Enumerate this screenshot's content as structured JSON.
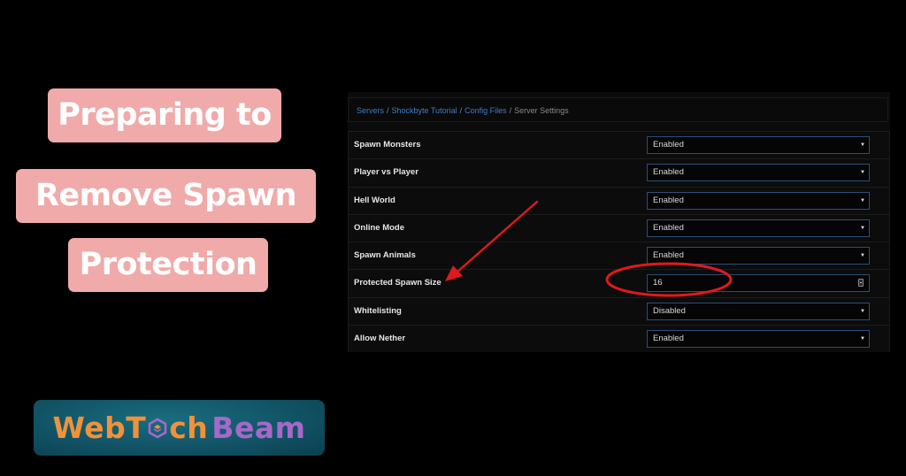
{
  "title_lines": [
    "Preparing to",
    "Remove Spawn",
    "Protection"
  ],
  "logo": {
    "part1": "WebT",
    "part2": "ch",
    "part3": "Beam",
    "colors": {
      "orange": "#f0923a",
      "purple": "#a668c9",
      "background": "#115466"
    }
  },
  "breadcrumb": {
    "items": [
      {
        "label": "Servers",
        "link": true
      },
      {
        "label": "Shockbyte Tutorial",
        "link": true
      },
      {
        "label": "Config Files",
        "link": true
      },
      {
        "label": "Server Settings",
        "link": false
      }
    ],
    "separator": "/"
  },
  "settings": [
    {
      "label": "Spawn Monsters",
      "type": "select",
      "value": "Enabled"
    },
    {
      "label": "Player vs Player",
      "type": "select",
      "value": "Enabled"
    },
    {
      "label": "Hell World",
      "type": "select",
      "value": "Enabled"
    },
    {
      "label": "Online Mode",
      "type": "select",
      "value": "Enabled"
    },
    {
      "label": "Spawn Animals",
      "type": "select",
      "value": "Enabled"
    },
    {
      "label": "Protected Spawn Size",
      "type": "number",
      "value": "16"
    },
    {
      "label": "Whitelisting",
      "type": "select",
      "value": "Disabled"
    },
    {
      "label": "Allow Nether",
      "type": "select",
      "value": "Enabled"
    }
  ],
  "icons": {
    "caret": "▼",
    "annotation_arrow": "red-arrow-icon",
    "annotation_circle": "red-circle-highlight"
  },
  "colors": {
    "pill": "#f0aaa9",
    "link": "#3d7ec9",
    "control_border": "#2b4f7a",
    "annotation": "#e0191e"
  }
}
